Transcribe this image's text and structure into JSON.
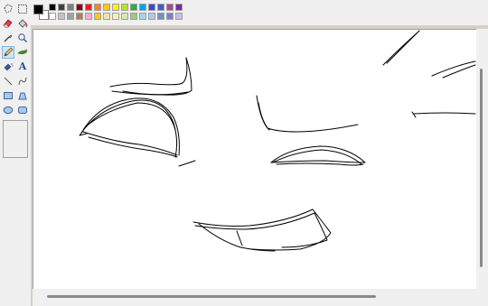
{
  "toolbox": {
    "tools": [
      {
        "name": "free-form-select",
        "icon": "free-form-select-icon",
        "active": false
      },
      {
        "name": "select",
        "icon": "select-icon",
        "active": false
      },
      {
        "name": "eraser",
        "icon": "eraser-icon",
        "active": false
      },
      {
        "name": "fill",
        "icon": "fill-bucket-icon",
        "active": false
      },
      {
        "name": "color-picker",
        "icon": "eyedropper-icon",
        "active": false
      },
      {
        "name": "magnifier",
        "icon": "magnifier-icon",
        "active": false
      },
      {
        "name": "pencil",
        "icon": "pencil-icon",
        "active": true
      },
      {
        "name": "brush",
        "icon": "brush-icon",
        "active": false
      },
      {
        "name": "airbrush",
        "icon": "airbrush-icon",
        "active": false
      },
      {
        "name": "text",
        "icon": "text-icon",
        "label": "A",
        "active": false
      },
      {
        "name": "line",
        "icon": "line-icon",
        "active": false
      },
      {
        "name": "curve",
        "icon": "curve-icon",
        "active": false
      },
      {
        "name": "rectangle",
        "icon": "rectangle-icon",
        "active": false
      },
      {
        "name": "polygon",
        "icon": "polygon-icon",
        "active": false
      },
      {
        "name": "ellipse",
        "icon": "ellipse-icon",
        "active": false
      },
      {
        "name": "rounded-rectangle",
        "icon": "rounded-rectangle-icon",
        "active": false
      }
    ]
  },
  "palette": {
    "primary": "#000000",
    "secondary": "#ffffff",
    "row1": [
      "#000000",
      "#404040",
      "#7f7f7f",
      "#880015",
      "#ed1c24",
      "#ff7f27",
      "#ffc90e",
      "#fff200",
      "#b5e61d",
      "#22b14c",
      "#00a2e8",
      "#3f48cc",
      "#4b57c8",
      "#a349a4",
      "#6f3198"
    ],
    "row2": [
      "#ffffff",
      "#c3c3c3",
      "#a0a0a0",
      "#b97a57",
      "#ffaec9",
      "#ffc90e",
      "#efe4b0",
      "#fff5a0",
      "#d8eba0",
      "#9ccb7c",
      "#99d9ea",
      "#b4c8e6",
      "#7092be",
      "#8080c0",
      "#c8bfe7"
    ]
  }
}
